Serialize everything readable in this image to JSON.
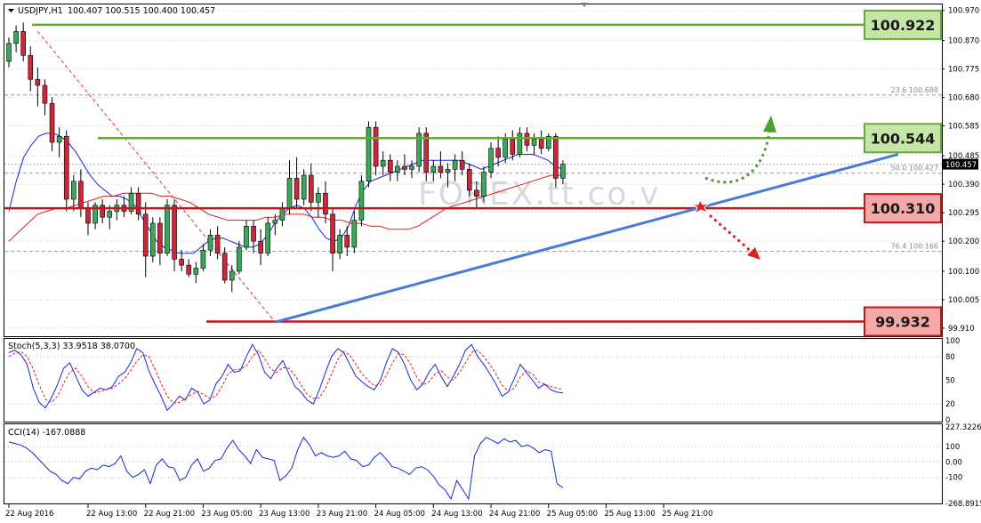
{
  "chart_data": {
    "type": "candlestick",
    "header": {
      "symbol": "USDJPY,H1",
      "ohlc": "100.407 100.515 100.400 100.457"
    },
    "y_axis": {
      "range": [
        99.88,
        100.99
      ],
      "ticks": [
        "100.970",
        "100.870",
        "100.775",
        "100.680",
        "100.585",
        "100.485",
        "100.390",
        "100.295",
        "100.200",
        "100.100",
        "100.005",
        "99.910"
      ],
      "tick_values": [
        100.97,
        100.87,
        100.775,
        100.68,
        100.585,
        100.485,
        100.39,
        100.295,
        100.2,
        100.1,
        100.005,
        99.91
      ],
      "current_price": "100.457"
    },
    "x_axis": {
      "labels": [
        "22 Aug 2016",
        "22 Aug 13:00",
        "22 Aug 21:00",
        "23 Aug 05:00",
        "23 Aug 13:00",
        "23 Aug 21:00",
        "24 Aug 05:00",
        "24 Aug 13:00",
        "24 Aug 21:00",
        "25 Aug 05:00",
        "25 Aug 13:00",
        "25 Aug 21:00"
      ],
      "label_bar_index": [
        0,
        11,
        19,
        27,
        35,
        43,
        51,
        59,
        67,
        75,
        83,
        91
      ]
    },
    "candles": [
      [
        100.8,
        100.88,
        100.78,
        100.86
      ],
      [
        100.86,
        100.92,
        100.83,
        100.9
      ],
      [
        100.9,
        100.93,
        100.8,
        100.82
      ],
      [
        100.82,
        100.85,
        100.7,
        100.74
      ],
      [
        100.74,
        100.78,
        100.65,
        100.72
      ],
      [
        100.72,
        100.74,
        100.62,
        100.66
      ],
      [
        100.66,
        100.68,
        100.5,
        100.53
      ],
      [
        100.53,
        100.58,
        100.48,
        100.55
      ],
      [
        100.55,
        100.57,
        100.3,
        100.34
      ],
      [
        100.34,
        100.42,
        100.3,
        100.4
      ],
      [
        100.4,
        100.44,
        100.28,
        100.31
      ],
      [
        100.31,
        100.33,
        100.22,
        100.26
      ],
      [
        100.26,
        100.33,
        100.24,
        100.32
      ],
      [
        100.32,
        100.34,
        100.26,
        100.28
      ],
      [
        100.28,
        100.32,
        100.24,
        100.3
      ],
      [
        100.3,
        100.34,
        100.27,
        100.32
      ],
      [
        100.32,
        100.35,
        100.28,
        100.3
      ],
      [
        100.3,
        100.38,
        100.29,
        100.36
      ],
      [
        100.36,
        100.38,
        100.27,
        100.29
      ],
      [
        100.29,
        100.33,
        100.08,
        100.15
      ],
      [
        100.15,
        100.28,
        100.13,
        100.26
      ],
      [
        100.26,
        100.28,
        100.12,
        100.16
      ],
      [
        100.16,
        100.34,
        100.15,
        100.32
      ],
      [
        100.32,
        100.34,
        100.1,
        100.14
      ],
      [
        100.14,
        100.17,
        100.1,
        100.12
      ],
      [
        100.12,
        100.14,
        100.08,
        100.09
      ],
      [
        100.09,
        100.13,
        100.06,
        100.11
      ],
      [
        100.11,
        100.19,
        100.1,
        100.17
      ],
      [
        100.17,
        100.24,
        100.15,
        100.22
      ],
      [
        100.22,
        100.25,
        100.14,
        100.16
      ],
      [
        100.16,
        100.18,
        100.06,
        100.07
      ],
      [
        100.07,
        100.12,
        100.03,
        100.1
      ],
      [
        100.1,
        100.2,
        100.09,
        100.18
      ],
      [
        100.18,
        100.27,
        100.17,
        100.25
      ],
      [
        100.25,
        100.27,
        100.16,
        100.2
      ],
      [
        100.2,
        100.24,
        100.12,
        100.16
      ],
      [
        100.16,
        100.28,
        100.15,
        100.26
      ],
      [
        100.26,
        100.29,
        100.22,
        100.27
      ],
      [
        100.27,
        100.33,
        100.25,
        100.31
      ],
      [
        100.31,
        100.47,
        100.29,
        100.41
      ],
      [
        100.41,
        100.48,
        100.31,
        100.34
      ],
      [
        100.34,
        100.44,
        100.32,
        100.42
      ],
      [
        100.42,
        100.46,
        100.3,
        100.33
      ],
      [
        100.33,
        100.38,
        100.28,
        100.36
      ],
      [
        100.36,
        100.4,
        100.26,
        100.29
      ],
      [
        100.29,
        100.31,
        100.1,
        100.16
      ],
      [
        100.16,
        100.24,
        100.14,
        100.22
      ],
      [
        100.22,
        100.25,
        100.15,
        100.18
      ],
      [
        100.18,
        100.3,
        100.16,
        100.27
      ],
      [
        100.27,
        100.42,
        100.25,
        100.4
      ],
      [
        100.4,
        100.6,
        100.38,
        100.58
      ],
      [
        100.58,
        100.6,
        100.42,
        100.45
      ],
      [
        100.45,
        100.5,
        100.42,
        100.47
      ],
      [
        100.47,
        100.49,
        100.4,
        100.43
      ],
      [
        100.43,
        100.47,
        100.4,
        100.45
      ],
      [
        100.45,
        100.49,
        100.42,
        100.44
      ],
      [
        100.44,
        100.47,
        100.41,
        100.45
      ],
      [
        100.45,
        100.58,
        100.43,
        100.56
      ],
      [
        100.56,
        100.58,
        100.4,
        100.43
      ],
      [
        100.43,
        100.47,
        100.4,
        100.45
      ],
      [
        100.45,
        100.5,
        100.41,
        100.43
      ],
      [
        100.43,
        100.46,
        100.38,
        100.44
      ],
      [
        100.44,
        100.49,
        100.4,
        100.47
      ],
      [
        100.47,
        100.5,
        100.42,
        100.44
      ],
      [
        100.44,
        100.46,
        100.35,
        100.37
      ],
      [
        100.37,
        100.4,
        100.31,
        100.35
      ],
      [
        100.35,
        100.45,
        100.33,
        100.43
      ],
      [
        100.43,
        100.53,
        100.41,
        100.51
      ],
      [
        100.51,
        100.55,
        100.45,
        100.48
      ],
      [
        100.48,
        100.56,
        100.46,
        100.54
      ],
      [
        100.54,
        100.57,
        100.47,
        100.49
      ],
      [
        100.49,
        100.58,
        100.48,
        100.56
      ],
      [
        100.56,
        100.58,
        100.5,
        100.52
      ],
      [
        100.52,
        100.56,
        100.49,
        100.54
      ],
      [
        100.54,
        100.57,
        100.49,
        100.51
      ],
      [
        100.51,
        100.56,
        100.5,
        100.55
      ],
      [
        100.55,
        100.56,
        100.38,
        100.41
      ],
      [
        100.41,
        100.47,
        100.39,
        100.457
      ]
    ],
    "moving_averages": [
      {
        "color": "#1428d8",
        "values": [
          100.3,
          100.4,
          100.48,
          100.52,
          100.55,
          100.56,
          100.56,
          100.55,
          100.53,
          100.5,
          100.46,
          100.42,
          100.39,
          100.37,
          100.35,
          100.35,
          100.34,
          100.32,
          100.28,
          100.24,
          100.2,
          100.18,
          100.17,
          100.16,
          100.16,
          100.16,
          100.18,
          100.2,
          100.21,
          100.21,
          100.2,
          100.19,
          100.18,
          100.18,
          100.19,
          100.22,
          100.26,
          100.29,
          100.31,
          100.32,
          100.31,
          100.28,
          100.24,
          100.21,
          100.2,
          100.21,
          100.25,
          100.32,
          100.37,
          100.4,
          100.41,
          100.42,
          100.43,
          100.44,
          100.45,
          100.46,
          100.47,
          100.47,
          100.47,
          100.47,
          100.47,
          100.47,
          100.46,
          100.45,
          100.44,
          100.45,
          100.46,
          100.47,
          100.48,
          100.49,
          100.49,
          100.49,
          100.48,
          100.47,
          100.45,
          100.44
        ]
      },
      {
        "color": "#d82020",
        "values": [
          100.2,
          100.23,
          100.26,
          100.29,
          100.3,
          100.31,
          100.31,
          100.32,
          100.33,
          100.34,
          100.35,
          100.35,
          100.36,
          100.36,
          100.36,
          100.36,
          100.35,
          100.35,
          100.34,
          100.33,
          100.31,
          100.29,
          100.28,
          100.27,
          100.27,
          100.27,
          100.27,
          100.28,
          100.28,
          100.29,
          100.29,
          100.29,
          100.28,
          100.28,
          100.27,
          100.27,
          100.26,
          100.26,
          100.25,
          100.25,
          100.24,
          100.24,
          100.24,
          100.25,
          100.27,
          100.29,
          100.31,
          100.32,
          100.33,
          100.34,
          100.35,
          100.36,
          100.37,
          100.38,
          100.39,
          100.4,
          100.41,
          100.42,
          100.42
        ]
      }
    ],
    "horizontal_levels": [
      {
        "value": 100.922,
        "label": "100.922",
        "color": "#6aa83a",
        "label_bg": "#c6e6a8"
      },
      {
        "value": 100.544,
        "label": "100.544",
        "color": "#6aa83a",
        "label_bg": "#c6e6a8"
      },
      {
        "value": 100.31,
        "label": "100.310",
        "color": "#c01818",
        "label_bg": "#f5a8a8"
      },
      {
        "value": 99.932,
        "label": "99.932",
        "color": "#c01818",
        "label_bg": "#f5a8a8"
      }
    ],
    "fibonacci": [
      {
        "label": "23.6  100.688",
        "value": 100.688
      },
      {
        "label": "50.0  100.427",
        "value": 100.427
      },
      {
        "label": "76.4  100.166",
        "value": 100.166
      }
    ],
    "trendline_support": {
      "from": [
        37,
        99.93
      ],
      "to": [
        159,
        100.49
      ]
    },
    "fib_diagonal": {
      "from": [
        4,
        100.9
      ],
      "to": [
        37,
        99.93
      ]
    },
    "watermark": "FOREX.tt.co.v",
    "stoch": {
      "label": "Stoch(5,3,3) 33.9518 38.0700",
      "ticks": [
        "100",
        "80",
        "50",
        "20",
        "0"
      ],
      "tick_values": [
        100,
        80,
        50,
        20,
        0
      ],
      "main": [
        85,
        88,
        82,
        70,
        40,
        22,
        15,
        28,
        45,
        65,
        72,
        55,
        38,
        30,
        35,
        40,
        38,
        42,
        55,
        60,
        72,
        90,
        85,
        62,
        45,
        30,
        12,
        20,
        30,
        25,
        40,
        35,
        20,
        25,
        45,
        55,
        70,
        60,
        62,
        80,
        95,
        82,
        60,
        52,
        65,
        75,
        58,
        42,
        35,
        25,
        20,
        38,
        60,
        80,
        90,
        85,
        70,
        55,
        48,
        42,
        38,
        50,
        72,
        90,
        85,
        70,
        50,
        38,
        45,
        60,
        70,
        55,
        42,
        55,
        70,
        88,
        95,
        80,
        70,
        58,
        45,
        30,
        35,
        52,
        70,
        60,
        50,
        40,
        45,
        38,
        35,
        33.95
      ],
      "signal": [
        80,
        84,
        86,
        80,
        64,
        44,
        26,
        22,
        30,
        46,
        60,
        65,
        55,
        42,
        34,
        36,
        38,
        40,
        45,
        52,
        62,
        74,
        82,
        80,
        64,
        46,
        30,
        21,
        22,
        27,
        32,
        36,
        32,
        27,
        30,
        42,
        58,
        63,
        64,
        68,
        80,
        88,
        78,
        64,
        60,
        66,
        65,
        56,
        44,
        32,
        27,
        28,
        40,
        58,
        76,
        86,
        82,
        70,
        58,
        50,
        43,
        44,
        56,
        72,
        84,
        82,
        70,
        54,
        44,
        48,
        58,
        62,
        54,
        50,
        60,
        72,
        85,
        88,
        80,
        70,
        58,
        44,
        36,
        40,
        54,
        62,
        58,
        48,
        45,
        42,
        40,
        38.07
      ]
    },
    "cci": {
      "label": "CCI(14) -167.0888",
      "ticks": [
        "227.3226",
        "100",
        "0.00",
        "-100",
        "-268.8915"
      ],
      "tick_values": [
        227.3226,
        100,
        0,
        -100,
        -268.8915
      ],
      "values": [
        130,
        120,
        110,
        90,
        60,
        20,
        -20,
        -60,
        -80,
        -120,
        -140,
        -100,
        -110,
        -60,
        -40,
        -50,
        -20,
        -30,
        -10,
        40,
        -60,
        -100,
        -80,
        -50,
        -140,
        -20,
        20,
        -30,
        -40,
        -120,
        -100,
        -20,
        20,
        -60,
        -40,
        10,
        20,
        90,
        140,
        80,
        40,
        -10,
        80,
        30,
        20,
        10,
        -120,
        -90,
        -40,
        80,
        160,
        110,
        40,
        60,
        40,
        30,
        40,
        70,
        20,
        10,
        -30,
        -20,
        30,
        60,
        20,
        -30,
        -40,
        -60,
        -80,
        -40,
        -30,
        -50,
        -90,
        -150,
        -180,
        -240,
        -120,
        -180,
        -240,
        40,
        120,
        160,
        140,
        120,
        150,
        130,
        140,
        100,
        110,
        90,
        60,
        80,
        70,
        -140,
        -167
      ]
    }
  }
}
